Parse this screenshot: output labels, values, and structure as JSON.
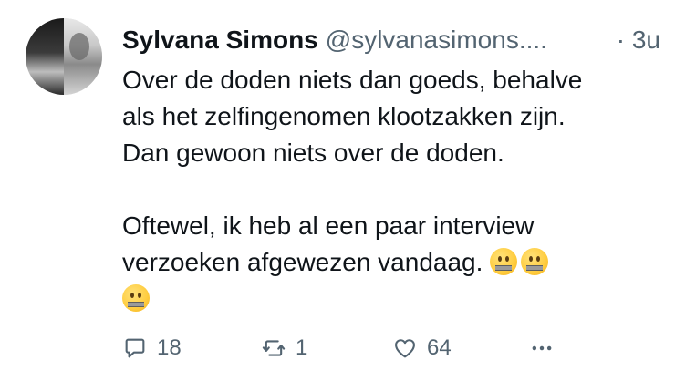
{
  "tweet": {
    "author": {
      "name": "Sylvana Simons",
      "handle": "@sylvanasimons....",
      "time": "· 3u"
    },
    "body": {
      "paragraph_1": [
        "Over de doden niets dan goeds, behalve",
        "als het zelfingenomen klootzakken zijn.",
        "Dan gewoon niets over de doden."
      ],
      "paragraph_2": [
        "Oftewel, ik heb al een paar interview",
        "verzoeken afgewezen vandaag."
      ],
      "emoji_name": "zipper-mouth-face",
      "emoji_count": 3
    },
    "actions": {
      "reply_count": "18",
      "retweet_count": "1",
      "like_count": "64"
    },
    "colors": {
      "text": "#0f1419",
      "secondary": "#536471",
      "background": "#ffffff"
    }
  }
}
